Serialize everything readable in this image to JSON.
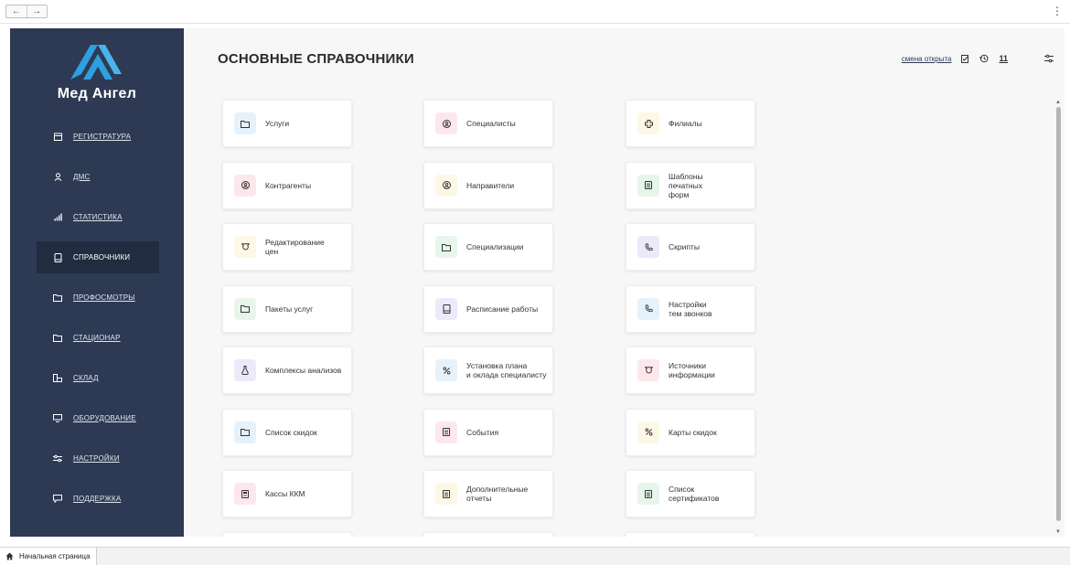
{
  "browser": {
    "back": "←",
    "forward": "→",
    "menu": "⋮"
  },
  "sidebar": {
    "brand": "Мед Ангел",
    "items": [
      {
        "label": "РЕГИСТРАТУРА",
        "icon": "calendar-icon"
      },
      {
        "label": "ДМС",
        "icon": "person-icon"
      },
      {
        "label": "СТАТИСТИКА",
        "icon": "bar-chart-icon"
      },
      {
        "label": "СПРАВОЧНИКИ",
        "icon": "book-icon",
        "active": true
      },
      {
        "label": "ПРОФОСМОТРЫ",
        "icon": "folder-icon"
      },
      {
        "label": "СТАЦИОНАР",
        "icon": "folder-icon"
      },
      {
        "label": "СКЛАД",
        "icon": "boxes-icon"
      },
      {
        "label": "ОБОРУДОВАНИЕ",
        "icon": "monitor-icon"
      },
      {
        "label": "НАСТРОЙКИ",
        "icon": "sliders-icon"
      },
      {
        "label": "ПОДДЕРЖКА",
        "icon": "chat-icon"
      }
    ]
  },
  "header": {
    "title": "ОСНОВНЫЕ СПРАВОЧНИКИ",
    "shift_status": "смена открыта",
    "count": "11"
  },
  "cards": [
    {
      "label": "Услуги",
      "color": "blue",
      "icon": "folder-icon"
    },
    {
      "label": "Специалисты",
      "color": "pink",
      "icon": "user-circle-icon"
    },
    {
      "label": "Филиалы",
      "color": "yellow",
      "icon": "plus-icon"
    },
    {
      "label": "Контрагенты",
      "color": "pink",
      "icon": "user-circle-icon"
    },
    {
      "label": "Направители",
      "color": "yellow",
      "icon": "user-circle-icon"
    },
    {
      "label": "Шаблоны\nпечатных\nформ",
      "color": "green",
      "icon": "document-icon"
    },
    {
      "label": "Редактирование\nцен",
      "color": "yellow",
      "icon": "tag-icon"
    },
    {
      "label": "Специализации",
      "color": "green",
      "icon": "folder-icon"
    },
    {
      "label": "Скрипты",
      "color": "purple",
      "icon": "phone-icon"
    },
    {
      "label": "Пакеты услуг",
      "color": "green",
      "icon": "folder-icon"
    },
    {
      "label": "Расписание работы",
      "color": "purple",
      "icon": "book-icon"
    },
    {
      "label": "Настройки\nтем звонков",
      "color": "blue",
      "icon": "phone-icon"
    },
    {
      "label": "Комплексы анализов",
      "color": "purple",
      "icon": "flask-icon"
    },
    {
      "label": "Установка плана\nи оклада специалисту",
      "color": "blue",
      "icon": "percent-icon"
    },
    {
      "label": "Источники\n информации",
      "color": "pink",
      "icon": "tag-icon"
    },
    {
      "label": "Список скидок",
      "color": "blue",
      "icon": "folder-icon"
    },
    {
      "label": "События",
      "color": "pink",
      "icon": "document-icon"
    },
    {
      "label": "Карты скидок",
      "color": "yellow",
      "icon": "percent-icon"
    },
    {
      "label": "Кассы ККМ",
      "color": "pink",
      "icon": "register-icon"
    },
    {
      "label": "Дополнительные\nотчеты",
      "color": "yellow",
      "icon": "document-icon"
    },
    {
      "label": "Список\nсертификатов",
      "color": "green",
      "icon": "document-icon"
    }
  ],
  "statusbar": {
    "tab_label": "Начальная страница"
  },
  "colors": {
    "sidebar": "#2e3a53",
    "active_item": "#222c40",
    "logo": "#2f9fe0"
  }
}
